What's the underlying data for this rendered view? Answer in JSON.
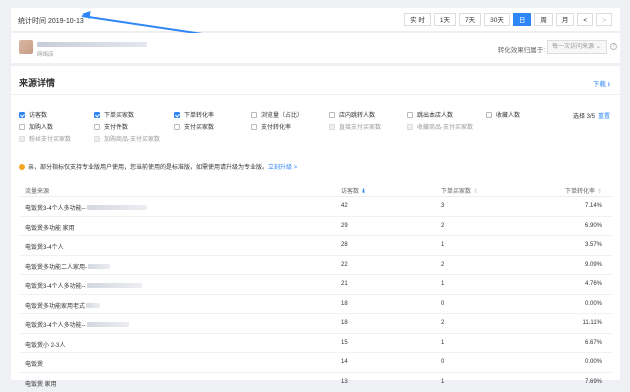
{
  "header": {
    "stat_time": "统计时间 2019-10-13",
    "periods": [
      {
        "label": "实 时",
        "active": false,
        "dim": false
      },
      {
        "label": "1天",
        "active": false,
        "dim": false
      },
      {
        "label": "7天",
        "active": false,
        "dim": false
      },
      {
        "label": "30天",
        "active": false,
        "dim": false
      },
      {
        "label": "日",
        "active": true,
        "dim": false
      },
      {
        "label": "周",
        "active": false,
        "dim": false
      },
      {
        "label": "月",
        "active": false,
        "dim": false
      },
      {
        "label": "<",
        "active": false,
        "dim": false
      },
      {
        "label": ">",
        "active": false,
        "dim": true
      }
    ]
  },
  "shop": {
    "sub_label": "网络店",
    "attribution_label": "转化效果归属于:",
    "attribution_value": "每一次访问来源",
    "help_icon": "?"
  },
  "panel": {
    "title": "来源详情",
    "download": "下载 ⭳"
  },
  "metrics": [
    {
      "label": "访客数",
      "checked": true,
      "disabled": false
    },
    {
      "label": "下单买家数",
      "checked": true,
      "disabled": false
    },
    {
      "label": "下单转化率",
      "checked": true,
      "disabled": false
    },
    {
      "label": "浏览量（占比）",
      "checked": false,
      "disabled": false
    },
    {
      "label": "店内跳转人数",
      "checked": false,
      "disabled": false
    },
    {
      "label": "跳出本店人数",
      "checked": false,
      "disabled": false
    },
    {
      "label": "收藏人数",
      "checked": false,
      "disabled": false
    },
    {
      "label": "加购人数",
      "checked": false,
      "disabled": false
    },
    {
      "label": "支付件数",
      "checked": false,
      "disabled": false
    },
    {
      "label": "支付买家数",
      "checked": false,
      "disabled": false
    },
    {
      "label": "支付转化率",
      "checked": false,
      "disabled": false
    },
    {
      "label": "直接支付买家数",
      "checked": false,
      "disabled": true
    },
    {
      "label": "收藏商品-支付买家数",
      "checked": false,
      "disabled": true
    },
    {
      "label": "粉丝支付买家数",
      "checked": false,
      "disabled": true
    },
    {
      "label": "加购商品-支付买家数",
      "checked": false,
      "disabled": true
    }
  ],
  "selection": {
    "count_text": "选择 3/5",
    "reset_label": "重置"
  },
  "notice": {
    "text": "亲，部分指标仅支持专业版用户使用，您当前使用的是标准版，如需使用请升级为专业版。",
    "link": "立刻升级 >"
  },
  "table": {
    "headers": {
      "source": "流量来源",
      "visitors": "访客数",
      "visitors_sort": "⬇",
      "buyers": "下单买家数",
      "buyers_sort": "⇕",
      "rate": "下单转化率",
      "rate_sort": "⇕"
    },
    "rows": [
      {
        "source": "电饭煲3-4个人多功能--",
        "visitors": "42",
        "buyers": "3",
        "rate": "7.14%"
      },
      {
        "source": "电饭煲多功能 家用",
        "visitors": "29",
        "buyers": "2",
        "rate": "6.90%"
      },
      {
        "source": "电饭煲3-4个人",
        "visitors": "28",
        "buyers": "1",
        "rate": "3.57%"
      },
      {
        "source": "电饭煲多功能二人家用-",
        "visitors": "22",
        "buyers": "2",
        "rate": "9.09%"
      },
      {
        "source": "电饭煲3-4个人多功能--",
        "visitors": "21",
        "buyers": "1",
        "rate": "4.76%"
      },
      {
        "source": "电饭煲多功能家用老式",
        "visitors": "18",
        "buyers": "0",
        "rate": "0.00%"
      },
      {
        "source": "电饭煲3-4个人多功能--",
        "visitors": "18",
        "buyers": "2",
        "rate": "11.11%"
      },
      {
        "source": "电饭煲小 2-3人",
        "visitors": "15",
        "buyers": "1",
        "rate": "6.67%"
      },
      {
        "source": "电饭煲",
        "visitors": "14",
        "buyers": "0",
        "rate": "0.00%"
      },
      {
        "source": "电饭煲 家用",
        "visitors": "13",
        "buyers": "1",
        "rate": "7.69%"
      }
    ]
  }
}
